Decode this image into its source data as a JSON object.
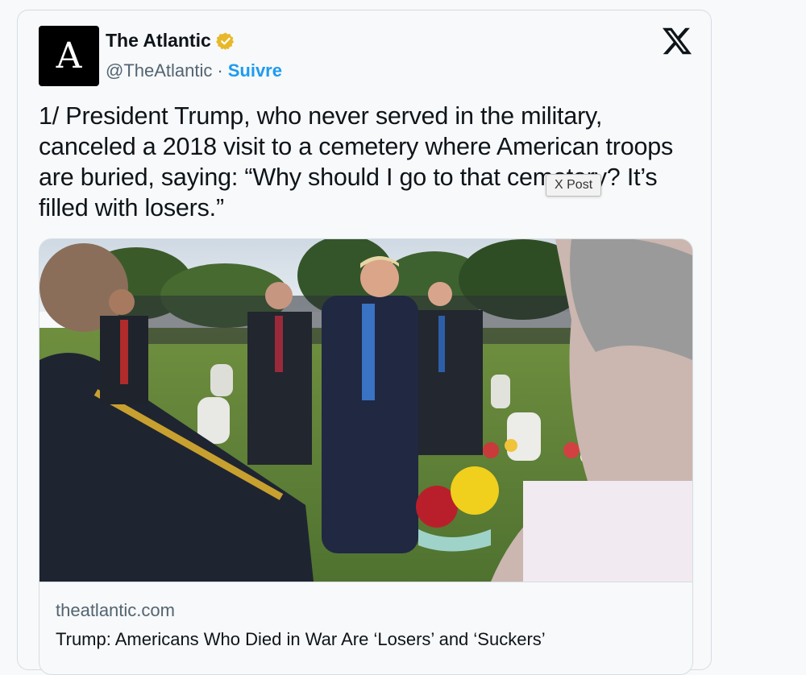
{
  "tweet": {
    "avatar_letter": "A",
    "display_name": "The Atlantic",
    "handle": "@TheAtlantic",
    "separator": "·",
    "follow_label": "Suivre",
    "text": "1/ President Trump, who never served in the military, canceled a 2018 visit to a cemetery where American troops are buried, saying: “Why should I go to that cemetery? It’s filled with losers.”",
    "tooltip": "X Post"
  },
  "link_card": {
    "domain": "theatlantic.com",
    "headline": "Trump: Americans Who Died in War Are ‘Losers’ and ‘Suckers’"
  },
  "colors": {
    "accent": "#1d9bf0",
    "verified_badge": "#e8b829",
    "text_primary": "#0f1419",
    "text_secondary": "#536471"
  },
  "icons": [
    "verified-badge-icon",
    "x-logo-icon"
  ]
}
